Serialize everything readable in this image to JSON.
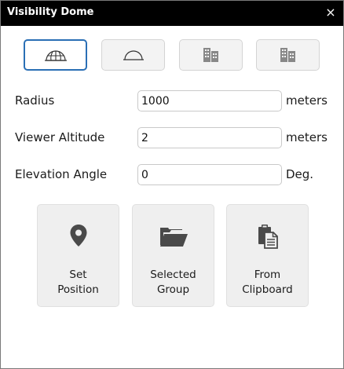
{
  "window": {
    "title": "Visibility Dome",
    "close_glyph": "×"
  },
  "mode_buttons": [
    {
      "icon": "globe-grid-icon",
      "active": true
    },
    {
      "icon": "dome-icon",
      "active": false
    },
    {
      "icon": "buildings-icon",
      "active": false
    },
    {
      "icon": "buildings-alt-icon",
      "active": false
    }
  ],
  "fields": {
    "radius": {
      "label": "Radius",
      "value": "1000",
      "unit": "meters"
    },
    "viewer_altitude": {
      "label": "Viewer Altitude",
      "value": "2",
      "unit": "meters"
    },
    "elevation_angle": {
      "label": "Elevation Angle",
      "value": "0",
      "unit": "Deg."
    }
  },
  "actions": {
    "set_position": {
      "line1": "Set",
      "line2": "Position",
      "icon": "map-pin-icon"
    },
    "selected_group": {
      "line1": "Selected",
      "line2": "Group",
      "icon": "folder-icon"
    },
    "from_clipboard": {
      "line1": "From",
      "line2": "Clipboard",
      "icon": "clipboard-icon"
    }
  },
  "colors": {
    "titlebar": "#000000",
    "active_border": "#2a6fb5",
    "button_bg": "#efefef",
    "icon": "#4a4a4a"
  }
}
